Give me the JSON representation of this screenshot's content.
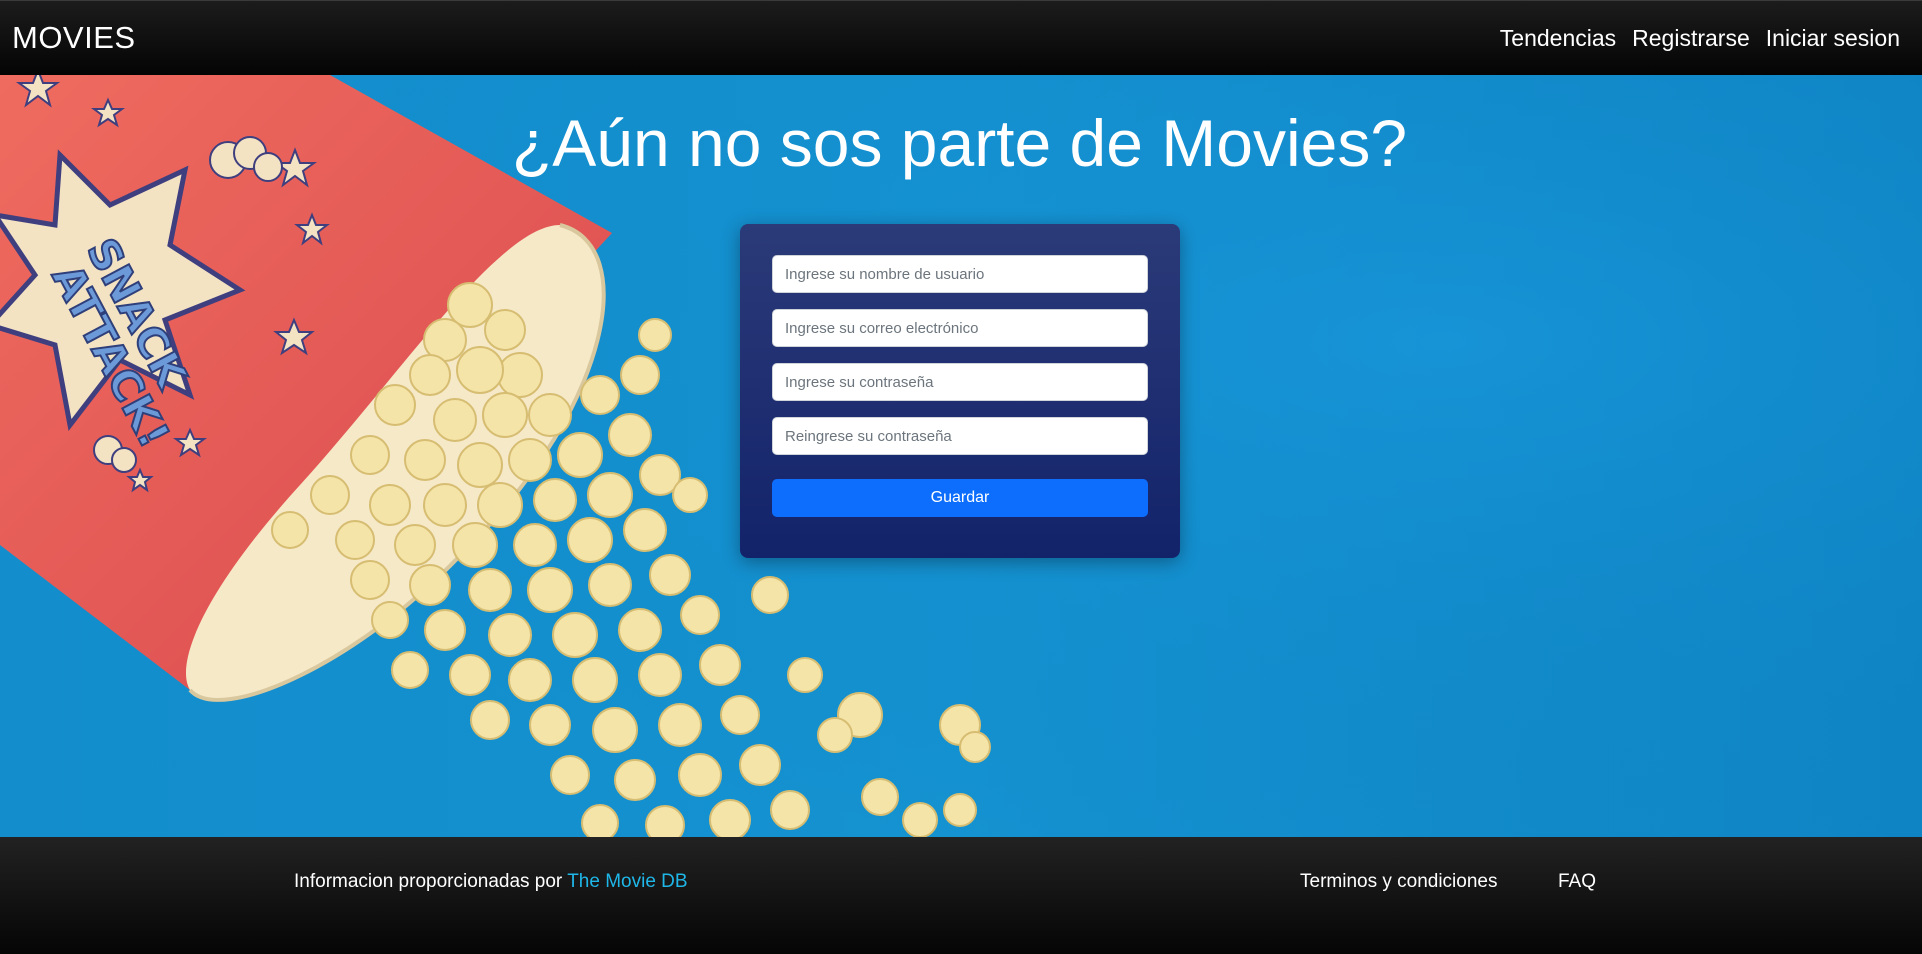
{
  "navbar": {
    "brand": "MOVIES",
    "links": [
      {
        "label": "Tendencias"
      },
      {
        "label": "Registrarse"
      },
      {
        "label": "Iniciar sesion"
      }
    ]
  },
  "hero": {
    "title": "¿Aún no sos parte de Movies?",
    "background_color": "#138dcc",
    "image_text": "SNACK ATTACK!"
  },
  "form": {
    "username_placeholder": "Ingrese su nombre de usuario",
    "email_placeholder": "Ingrese su correo electrónico",
    "password_placeholder": "Ingrese su contraseña",
    "password_confirm_placeholder": "Reingrese su contraseña",
    "submit_label": "Guardar",
    "accent_color": "#0d6efd"
  },
  "footer": {
    "credit_prefix": "Informacion proporcionadas por",
    "credit_link": "The Movie DB",
    "terms_label": "Terminos y condiciones",
    "faq_label": "FAQ",
    "link_color": "#1fb6e8"
  }
}
